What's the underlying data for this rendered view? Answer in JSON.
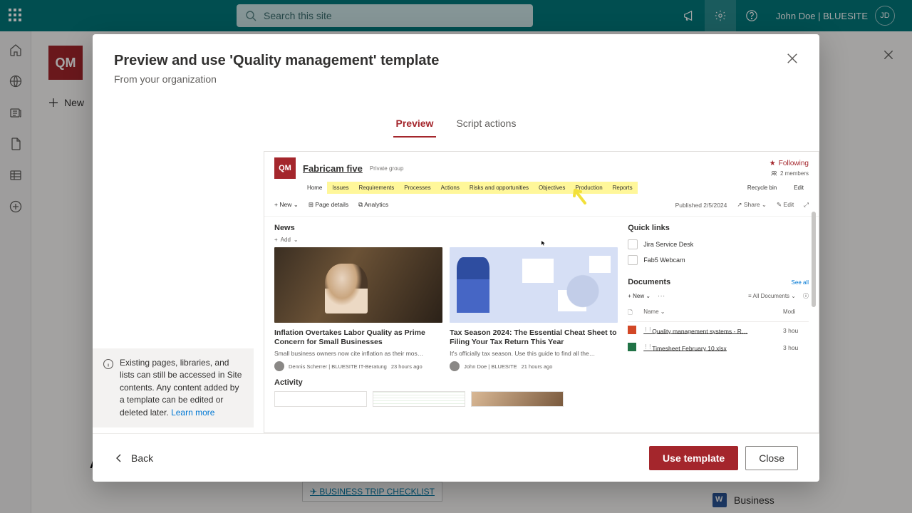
{
  "suite": {
    "search_placeholder": "Search this site",
    "user_label": "John Doe | BLUESITE",
    "user_initials": "JD"
  },
  "background": {
    "logo_text": "QM",
    "new_button": "New",
    "activity_heading": "A",
    "trip_link": "BUSINESS TRIP CHECKLIST",
    "doc_business": "Business"
  },
  "dialog": {
    "title": "Preview and use 'Quality management' template",
    "subtitle": "From your organization",
    "tabs": {
      "preview": "Preview",
      "script": "Script actions"
    },
    "info": {
      "text": "Existing pages, libraries, and lists can still be accessed in Site contents. Any content added by a template can be edited or deleted later. ",
      "learn_more": "Learn more"
    },
    "footer": {
      "back": "Back",
      "use": "Use template",
      "close": "Close"
    }
  },
  "preview": {
    "logo_text": "QM",
    "site_title": "Fabricam five",
    "privacy": "Private group",
    "following": "Following",
    "members": "2 members",
    "nav": {
      "home": "Home",
      "items": [
        "Issues",
        "Requirements",
        "Processes",
        "Actions",
        "Risks and opportunities",
        "Objectives",
        "Production",
        "Reports"
      ],
      "recycle": "Recycle bin",
      "edit": "Edit"
    },
    "cmdbar": {
      "new": "New",
      "page_details": "Page details",
      "analytics": "Analytics",
      "published": "Published 2/5/2024",
      "share": "Share",
      "edit_page": "Edit"
    },
    "news": {
      "heading": "News",
      "add": "Add",
      "cards": [
        {
          "title": "Inflation Overtakes Labor Quality as Prime Concern for Small Businesses",
          "desc": "Small business owners now cite inflation as their mos…",
          "author": "Dennis Scherrer | BLUESITE IT-Beratung",
          "when": "23 hours ago"
        },
        {
          "title": "Tax Season 2024: The Essential Cheat Sheet to Filing Your Tax Return This Year",
          "desc": "It's officially tax season. Use this guide to find all the…",
          "author": "John Doe | BLUESITE",
          "when": "21 hours ago"
        }
      ]
    },
    "quicklinks": {
      "heading": "Quick links",
      "items": [
        "Jira Service Desk",
        "Fab5 Webcam"
      ]
    },
    "documents": {
      "heading": "Documents",
      "see_all": "See all",
      "new": "New",
      "all_docs": "All Documents",
      "cols": {
        "name": "Name",
        "modified": "Modi"
      },
      "rows": [
        {
          "name": "Quality management systems - R…",
          "modified": "3 hou"
        },
        {
          "name": "Timesheet February 10.xlsx",
          "modified": "3 hou"
        }
      ]
    },
    "activity_heading": "Activity"
  }
}
